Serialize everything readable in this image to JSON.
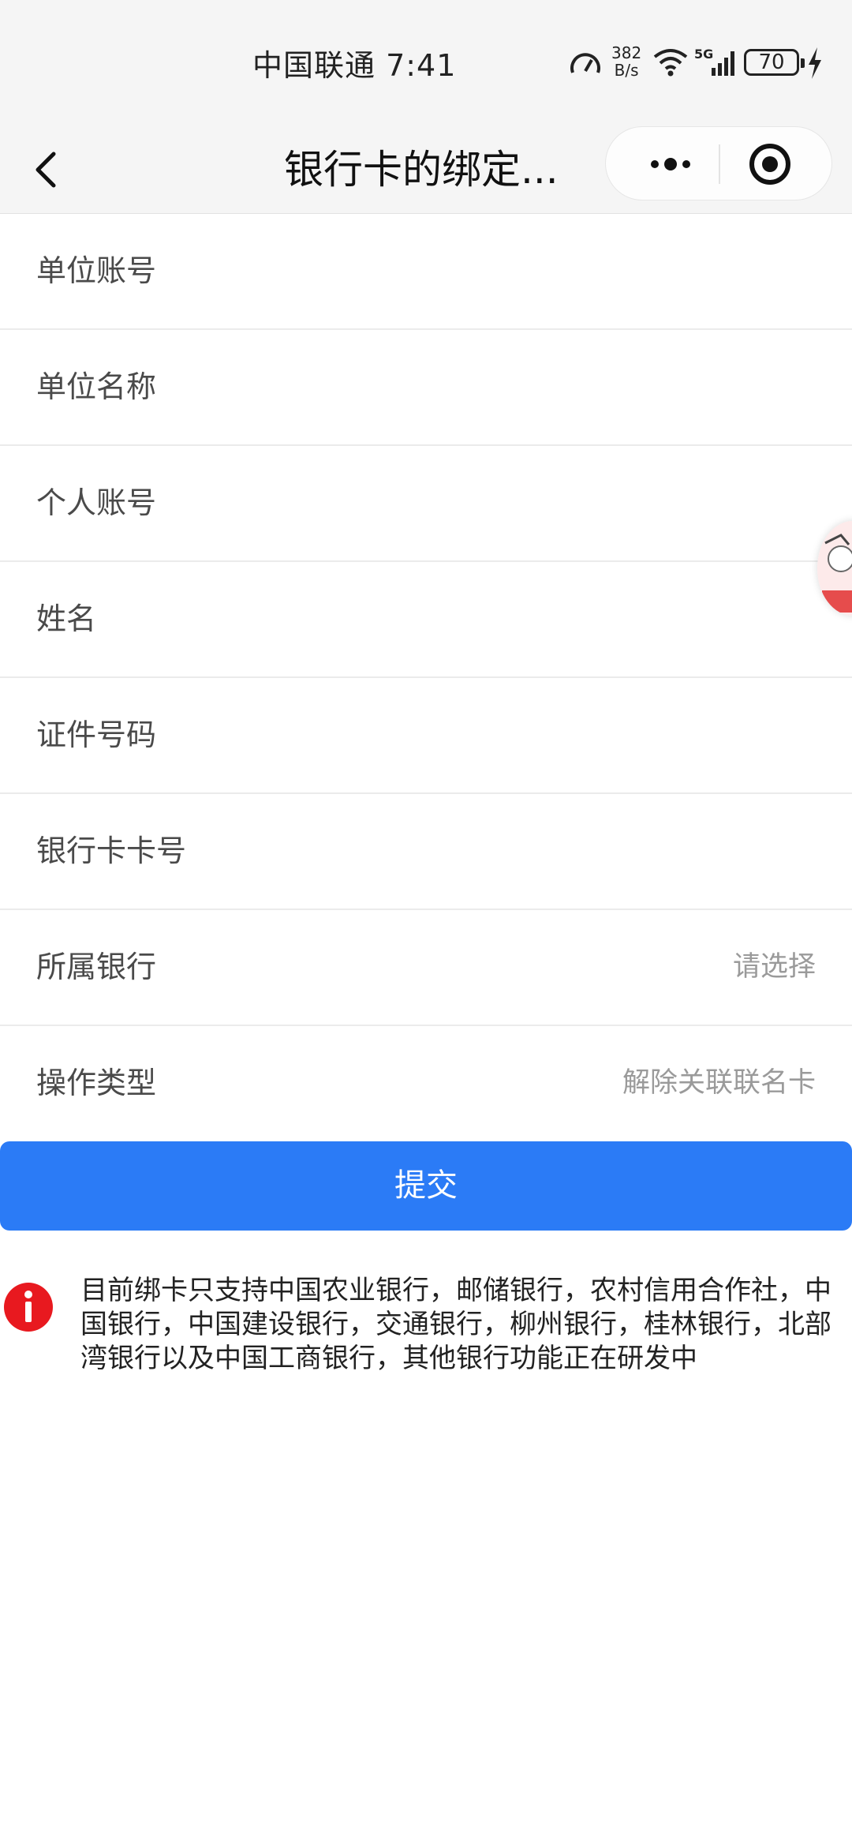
{
  "status_bar": {
    "carrier_time": "中国联通 7:41",
    "net_rate_value": "382",
    "net_rate_unit": "B/s",
    "network": "5G",
    "battery": "70"
  },
  "nav": {
    "title": "银行卡的绑定..."
  },
  "form": {
    "rows": [
      {
        "label": "单位账号",
        "value": ""
      },
      {
        "label": "单位名称",
        "value": ""
      },
      {
        "label": "个人账号",
        "value": ""
      },
      {
        "label": "姓名",
        "value": ""
      },
      {
        "label": "证件号码",
        "value": ""
      },
      {
        "label": "银行卡卡号",
        "value": ""
      },
      {
        "label": "所属银行",
        "value": "请选择"
      },
      {
        "label": "操作类型",
        "value": "解除关联联名卡"
      }
    ]
  },
  "submit_label": "提交",
  "notice": {
    "text": "目前绑卡只支持中国农业银行，邮储银行，农村信用合作社，中国银行，中国建设银行，交通银行，柳州银行，桂林银行，北部湾银行以及中国工商银行，其他银行功能正在研发中"
  },
  "colors": {
    "primary": "#2b7bf6",
    "alert": "#e8191f",
    "nav_bg": "#f5f5f5"
  }
}
